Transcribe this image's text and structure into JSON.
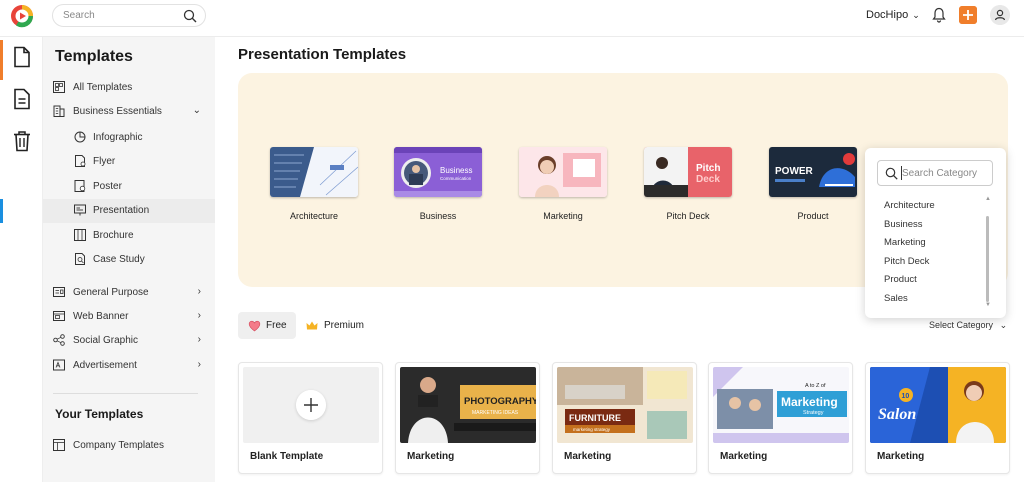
{
  "topbar": {
    "search_placeholder": "Search",
    "brand": "DocHipo",
    "brand_chevron": "⌄"
  },
  "rail": [
    "document-icon",
    "page-icon",
    "trash-icon"
  ],
  "sidebar": {
    "title": "Templates",
    "items": [
      {
        "label": "All Templates",
        "icon": "grid-icon"
      },
      {
        "label": "Business Essentials",
        "icon": "building-icon",
        "arrow": "⌄"
      },
      {
        "label": "Infographic",
        "icon": "chart-icon"
      },
      {
        "label": "Flyer",
        "icon": "flyer-icon"
      },
      {
        "label": "Poster",
        "icon": "poster-icon"
      },
      {
        "label": "Presentation",
        "icon": "presentation-icon"
      },
      {
        "label": "Brochure",
        "icon": "brochure-icon"
      },
      {
        "label": "Case Study",
        "icon": "case-study-icon"
      },
      {
        "label": "General Purpose",
        "icon": "id-card-icon",
        "arrow": "›"
      },
      {
        "label": "Web Banner",
        "icon": "web-banner-icon",
        "arrow": "›"
      },
      {
        "label": "Social Graphic",
        "icon": "share-icon",
        "arrow": "›"
      },
      {
        "label": "Advertisement",
        "icon": "advertisement-icon",
        "arrow": "›"
      }
    ],
    "your_templates_title": "Your Templates",
    "company_templates": "Company Templates"
  },
  "main": {
    "title": "Presentation Templates",
    "categories": [
      {
        "label": "Architecture",
        "color": "#3b5b8c"
      },
      {
        "label": "Business",
        "color": "#8b5fd6"
      },
      {
        "label": "Marketing",
        "color": "#f7b6be"
      },
      {
        "label": "Pitch Deck",
        "color": "#e8636a"
      },
      {
        "label": "Product",
        "color": "#1c2a3c"
      }
    ],
    "thumb_text": {
      "business_line1": "Business",
      "business_line2": "Communication",
      "pitch_line1": "Pitch",
      "pitch_line2": "Deck",
      "product_line": "POWER"
    },
    "dropdown": {
      "placeholder": "Search Category",
      "options": [
        "Architecture",
        "Business",
        "Marketing",
        "Pitch Deck",
        "Product",
        "Sales"
      ]
    },
    "filters": {
      "free": "Free",
      "premium": "Premium"
    },
    "select_category": "Select Category",
    "select_category_chevron": "⌄",
    "cards": [
      {
        "label": "Blank Template"
      },
      {
        "label": "Marketing",
        "headline": "PHOTOGRAPHY",
        "sub": "MARKETING IDEAS"
      },
      {
        "label": "Marketing",
        "headline": "FURNITURE",
        "sub": "marketing strategy"
      },
      {
        "label": "Marketing",
        "headline": "Marketing",
        "sub": "Strategy",
        "pre": "A to Z of"
      },
      {
        "label": "Marketing",
        "headline": "Salon",
        "badge": "10"
      }
    ]
  },
  "colors": {
    "accent": "#f07e2b",
    "hero_bg": "#fcf3e1",
    "selected_indicator": "#1a8fe0"
  }
}
